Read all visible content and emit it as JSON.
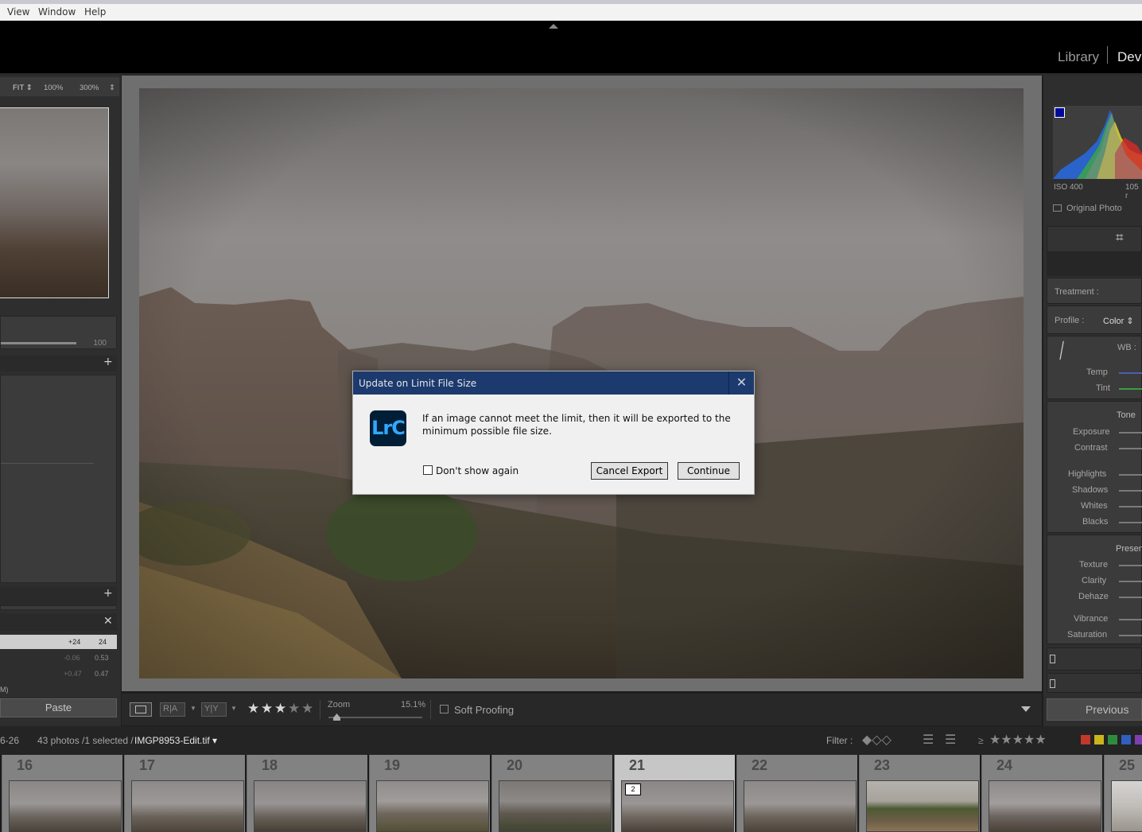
{
  "menubar": {
    "items": [
      "View",
      "Window",
      "Help"
    ]
  },
  "modules": {
    "library": "Library",
    "develop": "Deve"
  },
  "navigator": {
    "fit": "FIT",
    "z100": "100%",
    "z300": "300%"
  },
  "left_panel": {
    "slider_value": "100",
    "history": [
      {
        "a": "+24",
        "b": "24"
      },
      {
        "a": "-0.06",
        "b": "0.53"
      },
      {
        "a": "+0.47",
        "b": "0.47"
      }
    ],
    "partial_text": "M)",
    "paste_label": "Paste"
  },
  "toolbar": {
    "zoom_label": "Zoom",
    "zoom_value": "15.1%",
    "soft_proofing": "Soft Proofing",
    "rating": 3
  },
  "right_panel": {
    "iso": "ISO 400",
    "focal": "105 r",
    "original_photo": "Original Photo",
    "treatment": "Treatment :",
    "profile_label": "Profile :",
    "profile_value": "Color",
    "wb": "WB :",
    "temp": "Temp",
    "tint": "Tint",
    "tone": "Tone",
    "exposure": "Exposure",
    "contrast": "Contrast",
    "highlights": "Highlights",
    "shadows": "Shadows",
    "whites": "Whites",
    "blacks": "Blacks",
    "presence": "Presenc",
    "texture": "Texture",
    "clarity": "Clarity",
    "dehaze": "Dehaze",
    "vibrance": "Vibrance",
    "saturation": "Saturation",
    "previous": "Previous"
  },
  "filmstrip_bar": {
    "date": "6-26",
    "count": "43 photos /1 selected /",
    "filename": "IMGP8953-Edit.tif",
    "filter": "Filter :",
    "geq": "≥"
  },
  "filmstrip": {
    "cells": [
      "16",
      "17",
      "18",
      "19",
      "20",
      "21",
      "22",
      "23",
      "24",
      "25"
    ],
    "active_badge": "2"
  },
  "dialog": {
    "title": "Update on Limit File Size",
    "close": "✕",
    "icon_text": "LrC",
    "message": "If an image cannot meet the limit, then it will be exported to the minimum possible file size.",
    "checkbox_label": "Don't show again",
    "cancel": "Cancel Export",
    "continue": "Continue"
  },
  "colors": {
    "dialog_title_bar": "#1c3a6e",
    "lrc_bg": "#001e36",
    "lrc_text": "#31a8ff",
    "filter_labels": [
      "#c0392b",
      "#c9b51d",
      "#2e8b3e",
      "#2f5fc0",
      "#7e3fb0"
    ]
  }
}
